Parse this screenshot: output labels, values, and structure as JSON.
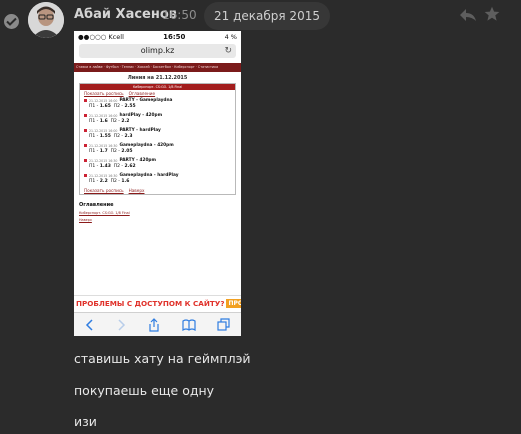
{
  "message": {
    "author": "Абай Хасенов",
    "time": "16:50",
    "date": "21 декабря 2015",
    "texts": [
      "ставишь хату на геймплэй",
      "покупаешь еще одну",
      "изи"
    ]
  },
  "actions": {
    "reply_icon": "reply-arrow-icon",
    "star_icon": "star-icon"
  },
  "phone_screenshot": {
    "carrier": "●●○○○ Kcell",
    "clock": "16:50",
    "battery": "4 %",
    "url": "olimp.kz",
    "nav_text": "Ставки в лайве · Футбол · Теннис · Хоккей · Баскетбол · Киберспорт · Статистика",
    "page_title": "Линия на 21.12.2015",
    "box_header": "Киберспорт. CS:GO. 1/8 Final",
    "link_show_all": "Показать роспись",
    "link_contents": "Оглавление",
    "events": [
      {
        "ts": "21.12.2015 16:00",
        "name": "PARTY - Gameplaydna",
        "p1": "1.65",
        "p2": "2.55"
      },
      {
        "ts": "21.12.2015 16:00",
        "name": "hardPlay - 420pm",
        "p1": "1.6",
        "p2": "2.2"
      },
      {
        "ts": "21.12.2015 16:00",
        "name": "PARTY - hardPlay",
        "p1": "1.55",
        "p2": "2.3"
      },
      {
        "ts": "21.12.2015 16:30",
        "name": "Gameplaydna - 420pm",
        "p1": "1.7",
        "p2": "2.05"
      },
      {
        "ts": "21.12.2015 16:30",
        "name": "PARTY - 420pm",
        "p1": "1.43",
        "p2": "2.62"
      },
      {
        "ts": "21.12.2015 16:30",
        "name": "Gameplaydna - hardPlay",
        "p1": "2.2",
        "p2": "1.6"
      }
    ],
    "p1_label": "П1 -",
    "p2_label": "П2 -",
    "link_up": "Наверх",
    "contents_heading": "Оглавление",
    "contents_item": "Киберспорт. CS:GO. 1/8 Final",
    "contents_up": "Наверх",
    "banner_text": "ПРОБЛЕМЫ С ДОСТУПОМ К САЙТУ?",
    "banner_button": "ПРОЧТИ"
  },
  "colors": {
    "background": "#2b2b2b",
    "site_red": "#a31d1d",
    "banner_red": "#e0312a",
    "banner_orange": "#f2a021"
  }
}
